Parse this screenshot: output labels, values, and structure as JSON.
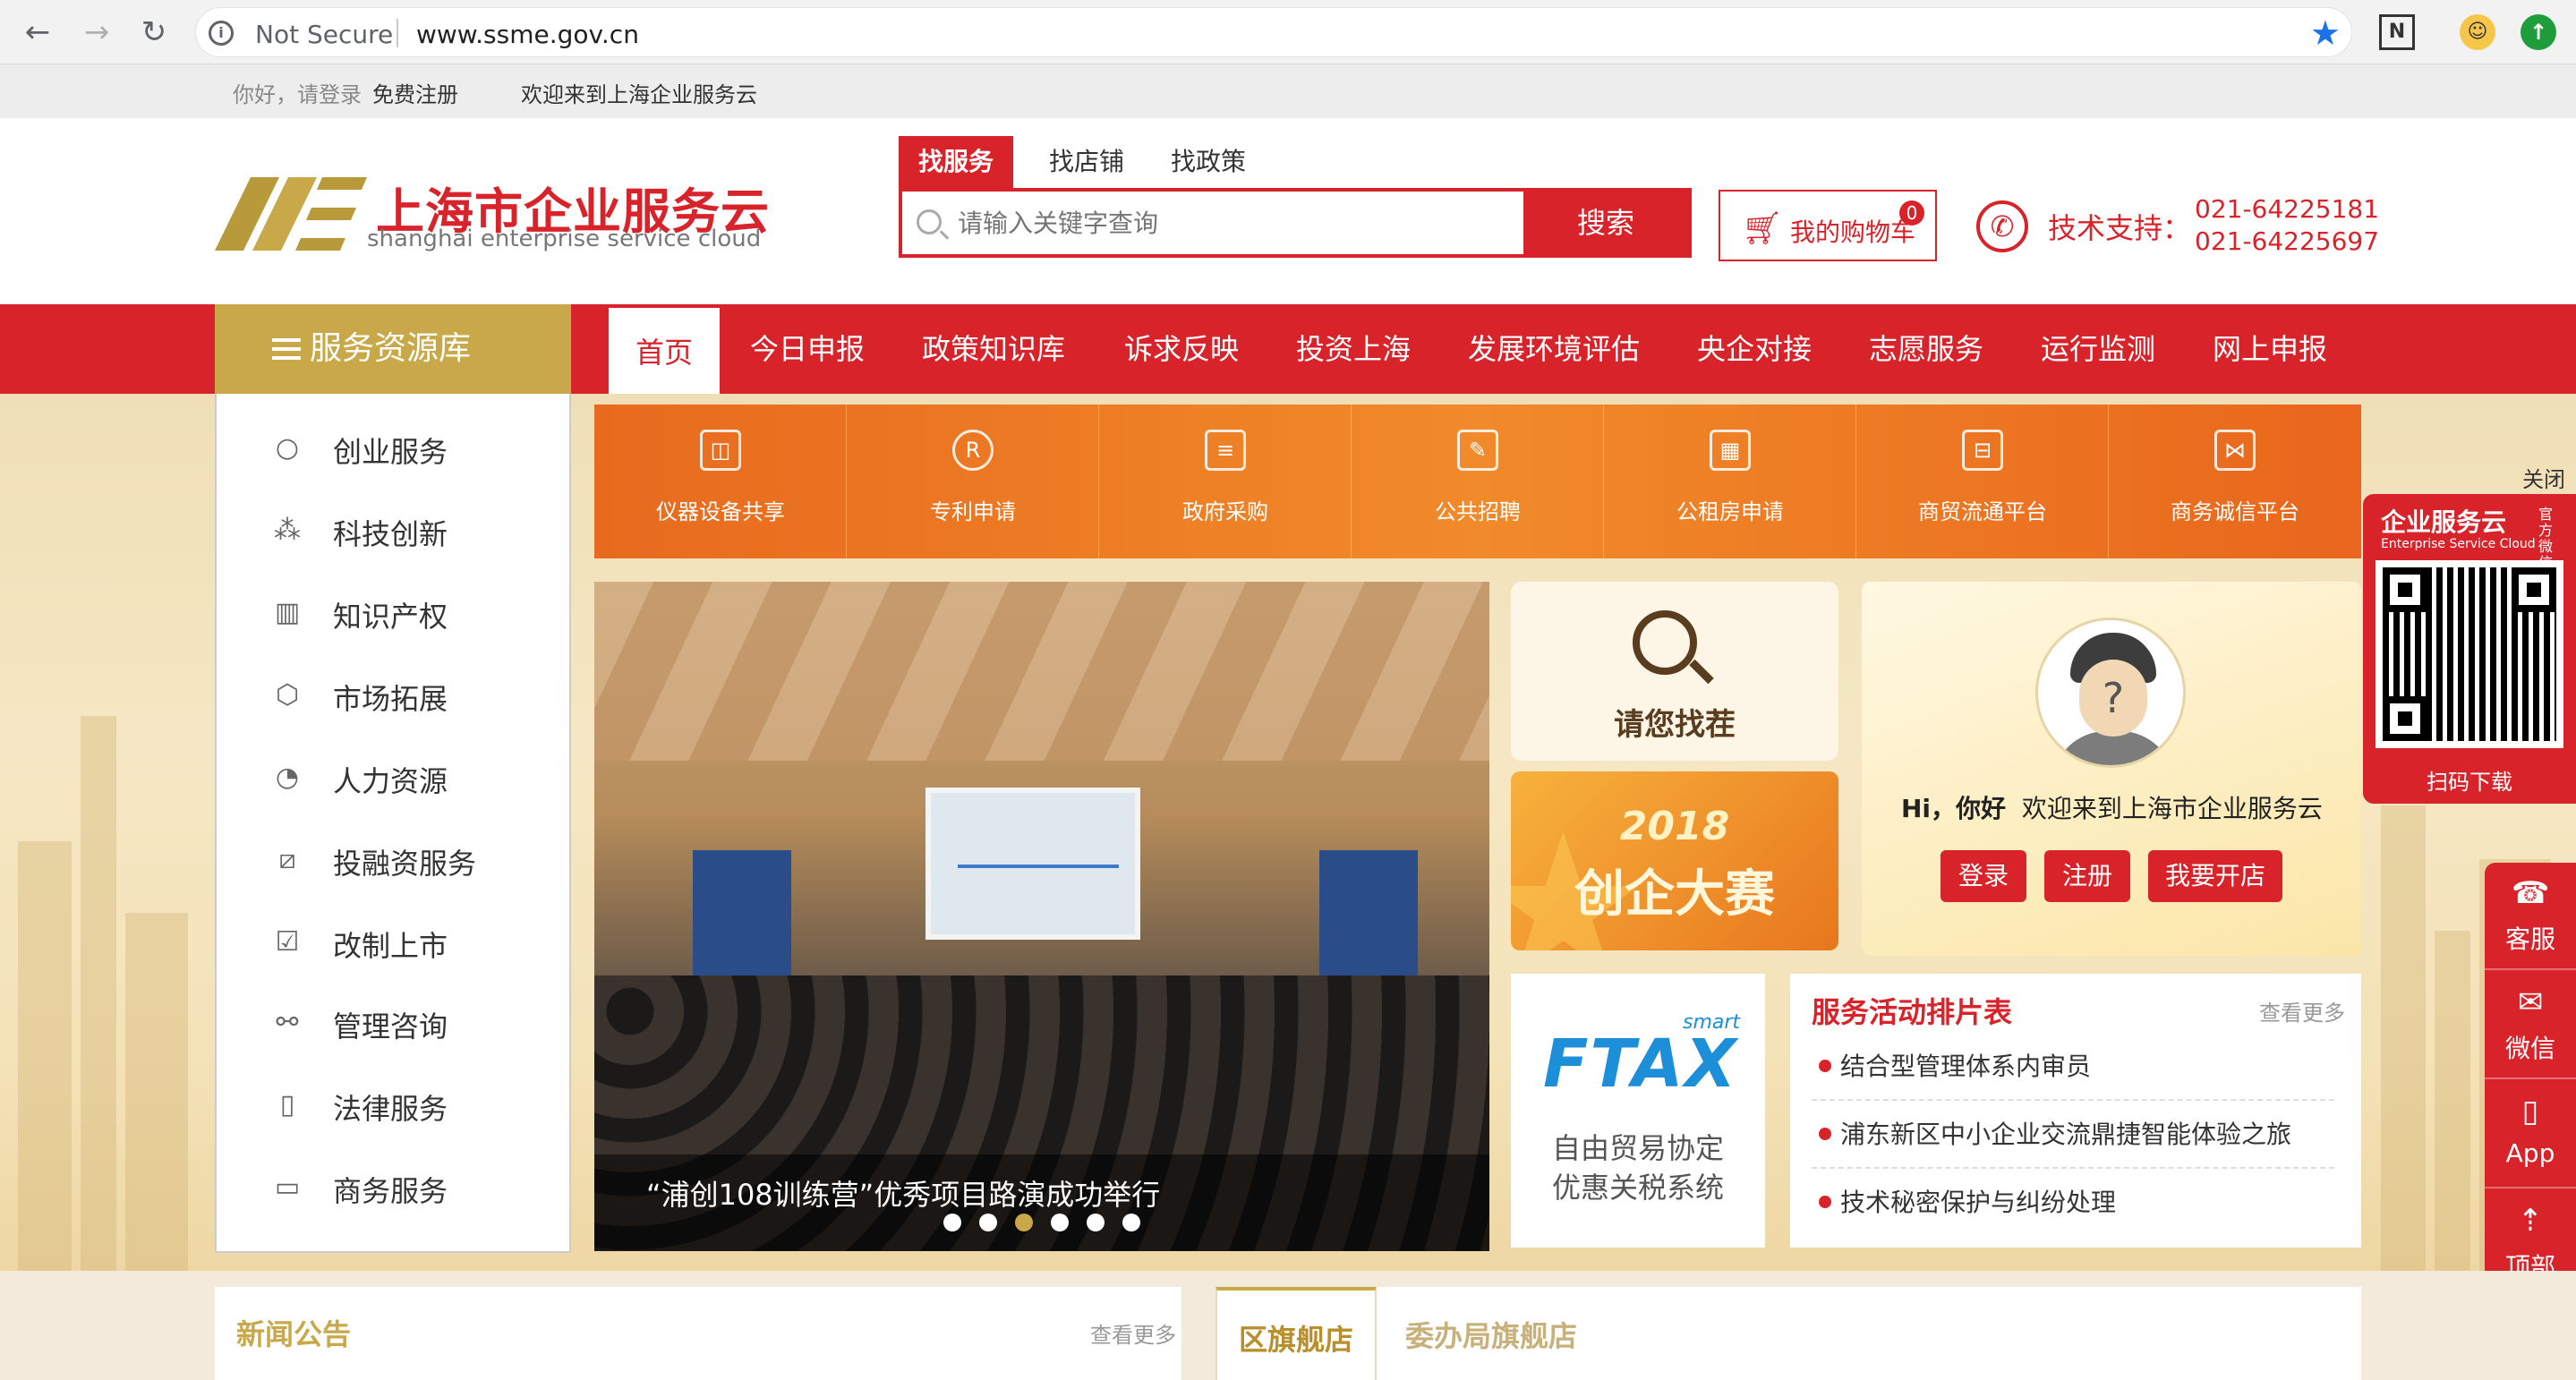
{
  "browser": {
    "security_label": "Not Secure",
    "url": "www.ssme.gov.cn",
    "extension_n": "N"
  },
  "topbar": {
    "greeting": "你好，请登录",
    "register": "免费注册",
    "welcome": "欢迎来到上海企业服务云"
  },
  "logo": {
    "name_cn": "上海市企业服务云",
    "name_en": "shanghai enterprise service cloud"
  },
  "search": {
    "tabs": [
      "找服务",
      "找店铺",
      "找政策"
    ],
    "active_tab": 0,
    "placeholder": "请输入关键字查询",
    "button": "搜索"
  },
  "cart": {
    "label": "我的购物车",
    "count": "0"
  },
  "support": {
    "label": "技术支持：",
    "phones": [
      "021-64225181",
      "021-64225697"
    ]
  },
  "colors": {
    "brand_red": "#d9232a",
    "gold": "#c9a84a",
    "orange": "#ee7d26"
  },
  "nav": {
    "resource_header": "服务资源库",
    "items": [
      "首页",
      "今日申报",
      "政策知识库",
      "诉求反映",
      "投资上海",
      "发展环境评估",
      "央企对接",
      "志愿服务",
      "运行监测",
      "网上申报"
    ],
    "active": 0
  },
  "sidebar": {
    "items": [
      {
        "label": "创业服务",
        "icon": "lightbulb-icon"
      },
      {
        "label": "科技创新",
        "icon": "network-icon"
      },
      {
        "label": "知识产权",
        "icon": "books-icon"
      },
      {
        "label": "市场拓展",
        "icon": "cube-icon"
      },
      {
        "label": "人力资源",
        "icon": "pie-chart-icon"
      },
      {
        "label": "投融资服务",
        "icon": "trend-chart-icon"
      },
      {
        "label": "改制上市",
        "icon": "document-check-icon"
      },
      {
        "label": "管理咨询",
        "icon": "nodes-icon"
      },
      {
        "label": "法律服务",
        "icon": "book-icon"
      },
      {
        "label": "商务服务",
        "icon": "briefcase-icon"
      }
    ]
  },
  "quick_services": [
    {
      "label": "仪器设备共享",
      "icon": "instrument-icon"
    },
    {
      "label": "专利申请",
      "icon": "registered-icon"
    },
    {
      "label": "政府采购",
      "icon": "documents-icon"
    },
    {
      "label": "公共招聘",
      "icon": "resume-icon"
    },
    {
      "label": "公租房申请",
      "icon": "building-icon"
    },
    {
      "label": "商贸流通平台",
      "icon": "briefcase-icon"
    },
    {
      "label": "商务诚信平台",
      "icon": "handshake-icon"
    }
  ],
  "carousel": {
    "caption": "“浦创108训练营”优秀项目路演成功举行",
    "slides": 6,
    "active_slide": 2
  },
  "find_box": {
    "label": "请您找茬"
  },
  "contest": {
    "year": "2018",
    "title": "创企大赛"
  },
  "ftax": {
    "smart": "smart",
    "logo": "FTAX",
    "line1": "自由贸易协定",
    "line2": "优惠关税系统"
  },
  "welcome_panel": {
    "hi": "Hi，你好",
    "message": "欢迎来到上海市企业服务云",
    "buttons": [
      "登录",
      "注册",
      "我要开店"
    ]
  },
  "activities": {
    "title": "服务活动排片表",
    "more": "查看更多",
    "items": [
      "结合型管理体系内审员",
      "浦东新区中小企业交流鼎捷智能体验之旅",
      "技术秘密保护与纠纷处理"
    ]
  },
  "qr": {
    "close": "关闭",
    "title": "企业服务云",
    "subtitle": "Enterprise Service Cloud",
    "vertical": "官方微信",
    "label": "扫码下载"
  },
  "tools": [
    {
      "label": "客服",
      "icon": "headset-icon"
    },
    {
      "label": "微信",
      "icon": "wechat-icon"
    },
    {
      "label": "App",
      "icon": "phone-icon"
    },
    {
      "label": "顶部",
      "icon": "arrow-up-icon"
    }
  ],
  "news": {
    "title": "新闻公告",
    "more": "查看更多"
  },
  "flagship": {
    "tabs": [
      "区旗舰店",
      "委办局旗舰店"
    ],
    "active": 0
  }
}
